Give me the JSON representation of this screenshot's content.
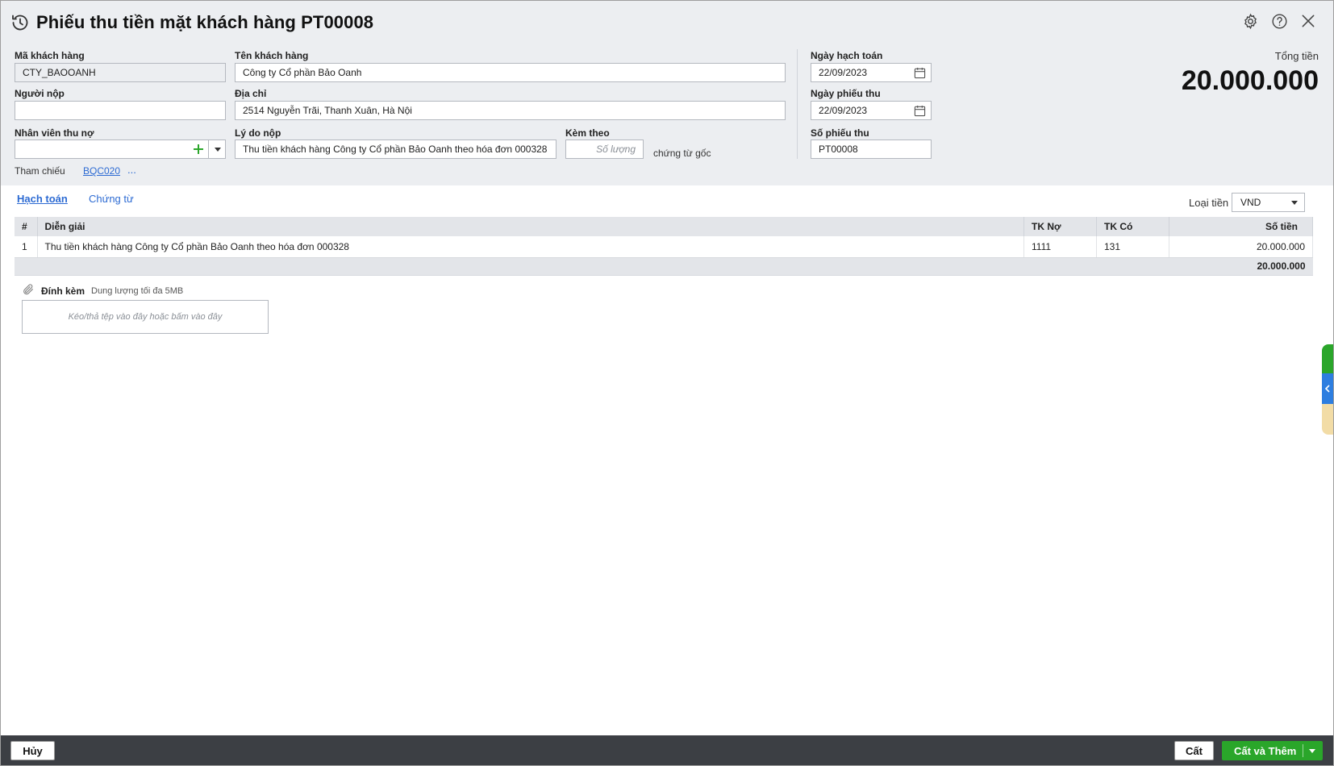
{
  "header": {
    "title": "Phiếu thu tiền mặt khách hàng PT00008"
  },
  "form": {
    "customer_code_label": "Mã khách hàng",
    "customer_code_value": "CTY_BAOOANH",
    "customer_name_label": "Tên khách hàng",
    "customer_name_value": "Công ty Cổ phần Bảo Oanh",
    "payer_label": "Người nộp",
    "payer_value": "",
    "address_label": "Địa chỉ",
    "address_value": "2514 Nguyễn Trãi, Thanh Xuân, Hà Nội",
    "collector_label": "Nhân viên thu nợ",
    "collector_value": "",
    "reason_label": "Lý do nộp",
    "reason_value": "Thu tiền khách hàng Công ty Cổ phần Bảo Oanh theo hóa đơn 000328",
    "attach_label": "Kèm theo",
    "attach_placeholder": "Số lượng",
    "attach_suffix": "chứng từ gốc",
    "posting_date_label": "Ngày hạch toán",
    "posting_date_value": "22/09/2023",
    "receipt_date_label": "Ngày phiếu thu",
    "receipt_date_value": "22/09/2023",
    "receipt_no_label": "Số phiếu thu",
    "receipt_no_value": "PT00008",
    "total_label": "Tổng tiền",
    "total_value": "20.000.000",
    "reference_label": "Tham chiếu",
    "reference_link": "BQC020",
    "reference_more": "..."
  },
  "tabs": [
    {
      "label": "Hạch toán",
      "active": true
    },
    {
      "label": "Chứng từ",
      "active": false
    }
  ],
  "currency": {
    "label": "Loại tiền",
    "value": "VND"
  },
  "grid": {
    "headers": [
      "#",
      "Diễn giải",
      "TK Nợ",
      "TK Có",
      "Số tiền"
    ],
    "rows": [
      {
        "no": "1",
        "description": "Thu tiền khách hàng Công ty Cổ phần Bảo Oanh theo hóa đơn 000328",
        "debit": "1111",
        "credit": "131",
        "amount": "20.000.000"
      }
    ],
    "footer_total": "20.000.000"
  },
  "attachment": {
    "title": "Đính kèm",
    "subtitle": "Dung lượng tối đa 5MB",
    "dropzone_text": "Kéo/thả tệp vào đây hoặc bấm vào đây"
  },
  "footer": {
    "cancel_label": "Hủy",
    "save_label": "Cất",
    "save_add_label": "Cất và Thêm"
  },
  "colors": {
    "accent": "#2d6bd3",
    "primary_button": "#2aa62a",
    "header_bg": "#eceef1",
    "footer_bg": "#3c3f44"
  },
  "icons": [
    "history-icon",
    "gear-icon",
    "help-icon",
    "close-icon",
    "calendar-icon",
    "plus-icon",
    "chevron-down-icon",
    "paperclip-icon"
  ]
}
